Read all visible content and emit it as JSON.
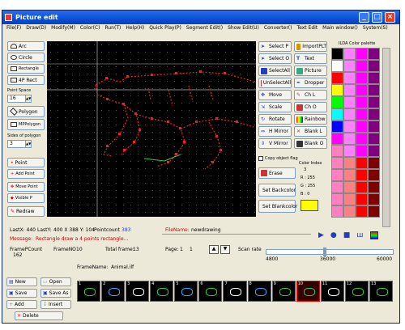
{
  "window": {
    "title": "Picture edit"
  },
  "menu": [
    "File(F)",
    "Draw(D)",
    "Modify(M)",
    "Color(C)",
    "Run(T)",
    "Help(H)",
    "Quick Play(P)",
    "Segment Edit()",
    "Show Edit(U)",
    "Converter()",
    "Text Edit",
    "Main window()",
    "System(S)"
  ],
  "left_tools": {
    "arc": "Arc",
    "circle": "Circle",
    "rectangle": "Rectangle",
    "rect4p": "4P Rect",
    "point_space_label": "Point Space",
    "point_space_value": "16",
    "polygon": "Polygon",
    "mppolygon": "MPPolygon",
    "sides_label": "Sides of polygon",
    "sides_value": "3",
    "point": "Point",
    "add_point": "Add Point",
    "move_point": "Move Point",
    "visible_p": "Visible P",
    "redraw": "Redraw"
  },
  "mid_tools": {
    "select_p": "Select P",
    "import_plt": "ImportPLT",
    "select_o": "Select O",
    "text": "Text",
    "select_all": "SelectAll",
    "picture": "Picture",
    "unselect_all": "UnSelectAll",
    "dropper": "Dropper",
    "move": "Move",
    "ch_l": "Ch L",
    "scale": "Scale",
    "ch_o": "Ch O",
    "rotate": "Rotate",
    "rainbow": "Rainbow",
    "h_mirror": "H Mirror",
    "blank_l": "Blank L",
    "v_mirror": "V Mirror",
    "blank_o": "Blank O",
    "copy_flag": "Copy object flag",
    "erase": "Erase",
    "set_back": "Set Backcolor",
    "set_blank": "Set Blankcolor"
  },
  "palette": {
    "title": "ILDA Color palette",
    "color_index_label": "Color Index",
    "color_index": "3",
    "r": "R : 255",
    "g": "G : 255",
    "b": "B : 0",
    "swatches": [
      "#000000",
      "#ff80ff",
      "#ff00ff",
      "#800080",
      "#ffffff",
      "#ff80ff",
      "#ff00ff",
      "#800080",
      "#ff0000",
      "#ff80ff",
      "#ff00ff",
      "#800080",
      "#ffff00",
      "#ff80ff",
      "#ff00ff",
      "#800080",
      "#00ff00",
      "#ff80ff",
      "#ff00ff",
      "#800080",
      "#00ffff",
      "#ff80ff",
      "#ff00ff",
      "#800080",
      "#0000ff",
      "#ff80ff",
      "#ff00ff",
      "#800080",
      "#ff00ff",
      "#ff80ff",
      "#ff00ff",
      "#800080",
      "#ff80c0",
      "#ff80ff",
      "#ff00ff",
      "#800080",
      "#ff80c0",
      "#ff8080",
      "#ff0000",
      "#800000",
      "#ff80c0",
      "#ff8080",
      "#ff0000",
      "#800000",
      "#ff80c0",
      "#ff8080",
      "#ff0000",
      "#800000",
      "#ff80c0",
      "#ff8080",
      "#ff0000",
      "#800000",
      "#ff80c0",
      "#ff8080",
      "#ff0000",
      "#800000"
    ],
    "selected": "#ffff00"
  },
  "status": {
    "lastx": "LastX: 440",
    "lasty": "LastY:",
    "pos": "400 X 388 Y: 104",
    "pointcount_label": "Pointcount",
    "pointcount": "383",
    "filename_label": "FileName:",
    "filename": "newdrawing",
    "message_label": "Message:",
    "message": "Rectangle draw a 4 points rectangle...",
    "framepcount_label": "FramePCount",
    "framepcount": "162",
    "frameno_label": "FrameNO",
    "frameno": "10",
    "totalframe_label": "Total frame:",
    "totalframe": "13",
    "page_label": "Page:",
    "page": "1",
    "page_total": "1",
    "scanrate_label": "Scan rate",
    "scan_min": "4800",
    "scan_mid": "36000",
    "scan_max": "60000",
    "framename_label": "FrameName:",
    "framename": "Animal.ilf"
  },
  "bottom": {
    "new": "New",
    "open": "Open",
    "save": "Save",
    "saveas": "Save As",
    "add": "Add",
    "insert": "Insert",
    "delete": "Delete"
  },
  "frames": [
    "1",
    "2",
    "3",
    "4",
    "5",
    "6",
    "7",
    "8",
    "9",
    "10",
    "11",
    "12",
    "13"
  ]
}
